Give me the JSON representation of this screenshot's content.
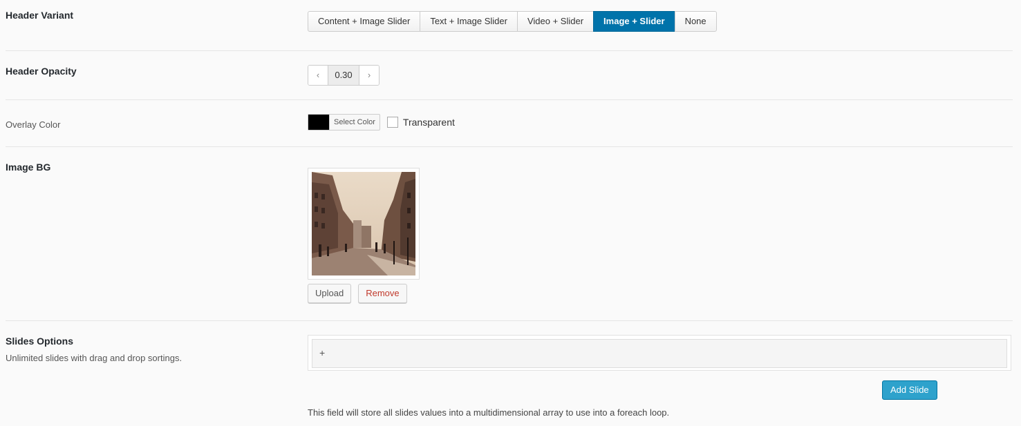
{
  "header_variant": {
    "label": "Header Variant",
    "options": [
      "Content + Image Slider",
      "Text + Image Slider",
      "Video + Slider",
      "Image + Slider",
      "None"
    ],
    "selected": "Image + Slider"
  },
  "header_opacity": {
    "label": "Header Opacity",
    "value": "0.30",
    "decrement_icon": "chevron-left-icon",
    "increment_icon": "chevron-right-icon"
  },
  "overlay_color": {
    "label": "Overlay Color",
    "swatch_color": "#000000",
    "button_label": "Select Color",
    "transparent_label": "Transparent",
    "transparent_checked": false
  },
  "image_bg": {
    "label": "Image BG",
    "upload_label": "Upload",
    "remove_label": "Remove"
  },
  "slides_options": {
    "label": "Slides Options",
    "description": "Unlimited slides with drag and drop sortings.",
    "add_icon": "+",
    "add_slide_label": "Add Slide",
    "note": "This field will store all slides values into a multidimensional array to use into a foreach loop."
  },
  "colors": {
    "active": "#0073aa",
    "add_slide": "#2ea2cc",
    "remove": "#c0392b"
  }
}
